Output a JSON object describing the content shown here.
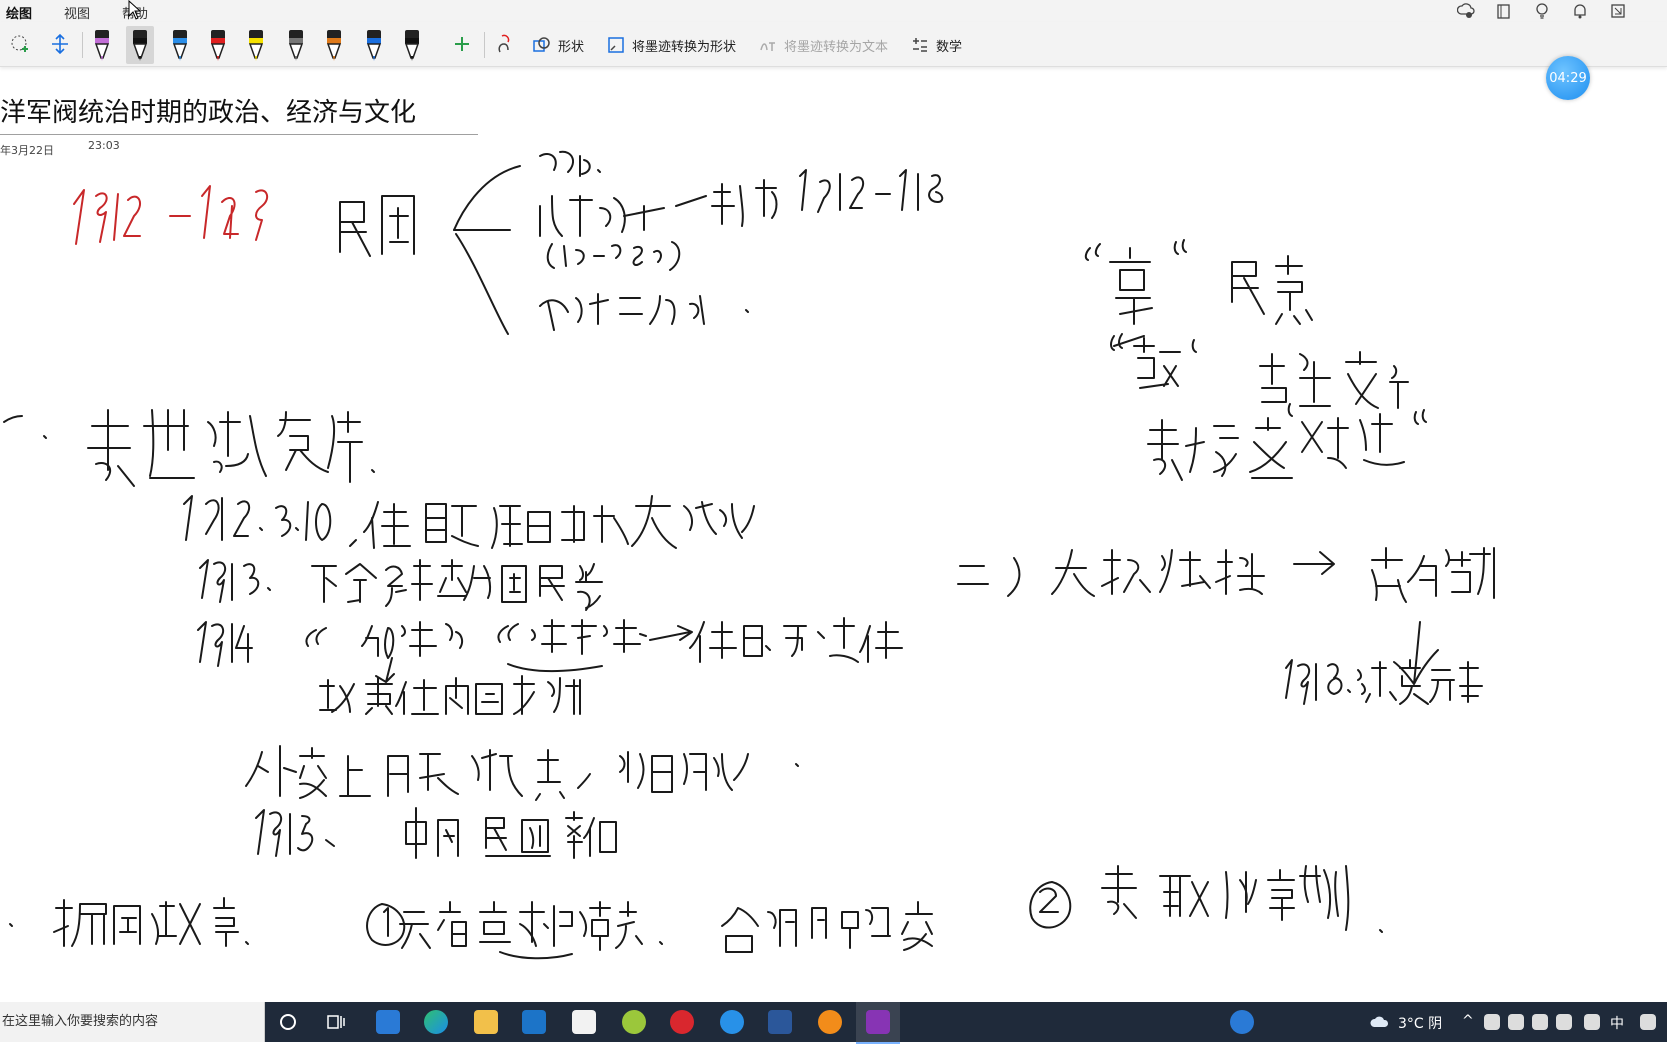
{
  "ribbon": {
    "tabs": [
      "绘图",
      "视图",
      "帮助"
    ],
    "active_tab": "绘图",
    "buttons": {
      "shapes": "形状",
      "ink_to_shape": "将墨迹转换为形状",
      "ink_to_text": "将墨迹转换为文本",
      "math": "数学"
    },
    "pens": [
      {
        "color": "#c26fd6",
        "selected": false
      },
      {
        "color": "#111111",
        "selected": true
      },
      {
        "color": "#2b8ee8",
        "selected": false
      },
      {
        "color": "#e02020",
        "selected": false
      },
      {
        "color": "#f5e100",
        "selected": false
      },
      {
        "color": "#777777",
        "selected": false
      },
      {
        "color": "#e07a1a",
        "selected": false
      },
      {
        "color": "#1a6fe0",
        "selected": false
      },
      {
        "color": "#111111",
        "selected": false
      }
    ]
  },
  "page": {
    "title": "洋军阀统治时期的政治、经济与文化",
    "date": "年3月22日",
    "time": "23:03",
    "timer": "04:29"
  },
  "taskbar": {
    "search_placeholder": "在这里输入你要搜索的内容",
    "weather": "3°C 阴",
    "ime": "中"
  },
  "colors": {
    "accent": "#7719aa",
    "ink_black": "#1a1a1a",
    "ink_red": "#c8282a"
  }
}
